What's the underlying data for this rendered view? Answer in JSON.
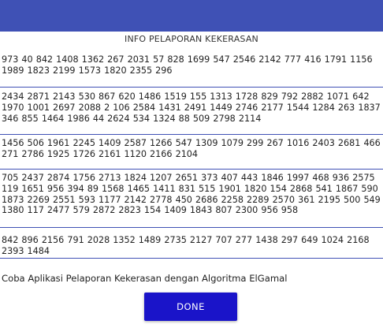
{
  "title": "INFO PELAPORAN KEKERASAN",
  "blocks": [
    "973 40 842 1408 1362 267 2031 57 828 1699 547 2546 2142 777 416 1791 1156 1989 1823 2199 1573 1820 2355 296",
    "2434 2871 2143 530 867 620 1486 1519 155 1313 1728 829 792 2882 1071 642 1970 1001 2697 2088 2 106 2584 1431 2491 1449 2746 2177 1544 1284 263 1837 346 855 1464 1986 44 2624 534 1324 88 509 2798 2114",
    "1456 506 1961 2245 1409 2587 1266 547 1309 1079 299 267 1016 2403 2681 466 271 2786 1925 1726 2161 1120 2166 2104",
    "705 2437 2874 1756 2713 1824 1207 2651 373 407 443 1846 1997 468 936 2575 119 1651 956 394 89 1568 1465 1411 831 515 1901 1820 154 2868 541 1867 590 1873 2269 2551 593 1177 2142 2778 450 2686 2258 2289 2570 361 2195 500 549 1380 117 2477 579 2872 2823 154 1409 1843 807 2300 956 958",
    "842 896 2156 791 2028 1352 1489 2735 2127 707 277 1438 297 649 1024 2168 2393 1484"
  ],
  "note": "Coba Aplikasi Pelaporan Kekerasan dengan Algoritma ElGamal",
  "done_label": "DONE"
}
